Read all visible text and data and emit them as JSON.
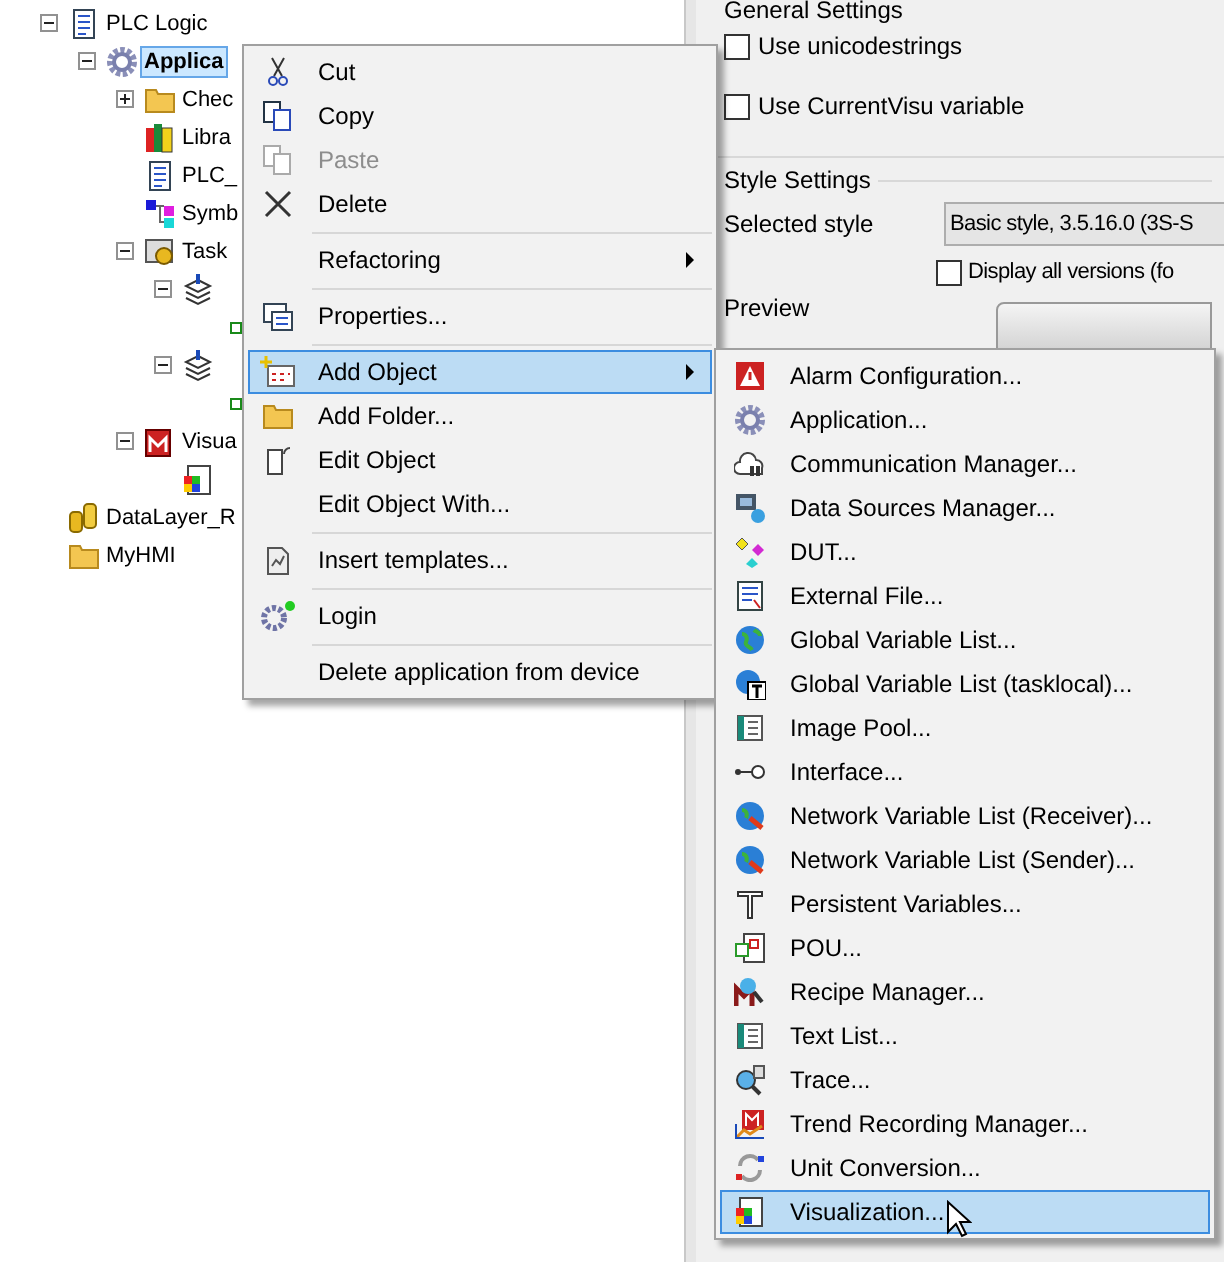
{
  "tree": [
    {
      "label": "PLC Logic",
      "expanded": true,
      "selected": false,
      "children": [
        {
          "label": "Applica",
          "expanded": true,
          "selected": true,
          "children": [
            {
              "label": "Chec",
              "expanded": false,
              "selected": false
            },
            {
              "label": "Libra",
              "selected": false
            },
            {
              "label": "PLC_",
              "selected": false
            },
            {
              "label": "Symb",
              "selected": false
            },
            {
              "label": "Task",
              "expanded": true,
              "selected": false,
              "children": [
                {
                  "expanded": true,
                  "selected": false,
                  "children": [
                    {
                      "selected": false
                    }
                  ]
                },
                {
                  "expanded": true,
                  "selected": false,
                  "children": [
                    {
                      "selected": false
                    }
                  ]
                }
              ]
            },
            {
              "label": "Visua",
              "expanded": true,
              "selected": false,
              "children": [
                {
                  "selected": false
                }
              ]
            }
          ]
        }
      ]
    },
    {
      "label": "DataLayer_R",
      "selected": false
    },
    {
      "label": "MyHMI",
      "selected": false
    }
  ],
  "settings": {
    "general_heading": "General Settings",
    "options": [
      {
        "label": "Use unicodestrings",
        "checked": false
      },
      {
        "label": "Use CurrentVisu variable",
        "checked": false
      }
    ],
    "style_heading": "Style Settings",
    "selected_style_label": "Selected style",
    "selected_style_value": "Basic style, 3.5.16.0 (3S-S",
    "display_all": {
      "label": "Display all versions (fo",
      "checked": false
    },
    "preview_label": "Preview"
  },
  "context_menu": [
    {
      "kind": "item",
      "label": "Cut",
      "disabled": false,
      "submenu": false,
      "selected": false
    },
    {
      "kind": "item",
      "label": "Copy",
      "disabled": false,
      "submenu": false,
      "selected": false
    },
    {
      "kind": "item",
      "label": "Paste",
      "disabled": true,
      "submenu": false,
      "selected": false
    },
    {
      "kind": "item",
      "label": "Delete",
      "disabled": false,
      "submenu": false,
      "selected": false
    },
    {
      "kind": "separator"
    },
    {
      "kind": "item",
      "label": "Refactoring",
      "disabled": false,
      "submenu": true,
      "selected": false
    },
    {
      "kind": "separator"
    },
    {
      "kind": "item",
      "label": "Properties...",
      "disabled": false,
      "submenu": false,
      "selected": false
    },
    {
      "kind": "separator"
    },
    {
      "kind": "item",
      "label": "Add Object",
      "disabled": false,
      "submenu": true,
      "selected": true
    },
    {
      "kind": "item",
      "label": "Add Folder...",
      "disabled": false,
      "submenu": false,
      "selected": false
    },
    {
      "kind": "item",
      "label": "Edit Object",
      "disabled": false,
      "submenu": false,
      "selected": false
    },
    {
      "kind": "item",
      "label": "Edit Object With...",
      "disabled": false,
      "submenu": false,
      "selected": false
    },
    {
      "kind": "separator"
    },
    {
      "kind": "item",
      "label": "Insert templates...",
      "disabled": false,
      "submenu": false,
      "selected": false
    },
    {
      "kind": "separator"
    },
    {
      "kind": "item",
      "label": "Login",
      "disabled": false,
      "submenu": false,
      "selected": false
    },
    {
      "kind": "separator"
    },
    {
      "kind": "item",
      "label": "Delete application from device",
      "disabled": false,
      "submenu": false,
      "selected": false
    }
  ],
  "submenu": [
    {
      "label": "Alarm Configuration...",
      "selected": false
    },
    {
      "label": "Application...",
      "selected": false
    },
    {
      "label": "Communication Manager...",
      "selected": false
    },
    {
      "label": "Data Sources Manager...",
      "selected": false
    },
    {
      "label": "DUT...",
      "selected": false
    },
    {
      "label": "External File...",
      "selected": false
    },
    {
      "label": "Global Variable List...",
      "selected": false
    },
    {
      "label": "Global Variable List (tasklocal)...",
      "selected": false
    },
    {
      "label": "Image Pool...",
      "selected": false
    },
    {
      "label": "Interface...",
      "selected": false
    },
    {
      "label": "Network Variable List (Receiver)...",
      "selected": false
    },
    {
      "label": "Network Variable List (Sender)...",
      "selected": false
    },
    {
      "label": "Persistent Variables...",
      "selected": false
    },
    {
      "label": "POU...",
      "selected": false
    },
    {
      "label": "Recipe Manager...",
      "selected": false
    },
    {
      "label": "Text List...",
      "selected": false
    },
    {
      "label": "Trace...",
      "selected": false
    },
    {
      "label": "Trend Recording Manager...",
      "selected": false
    },
    {
      "label": "Unit Conversion...",
      "selected": false
    },
    {
      "label": "Visualization...",
      "selected": true
    }
  ]
}
